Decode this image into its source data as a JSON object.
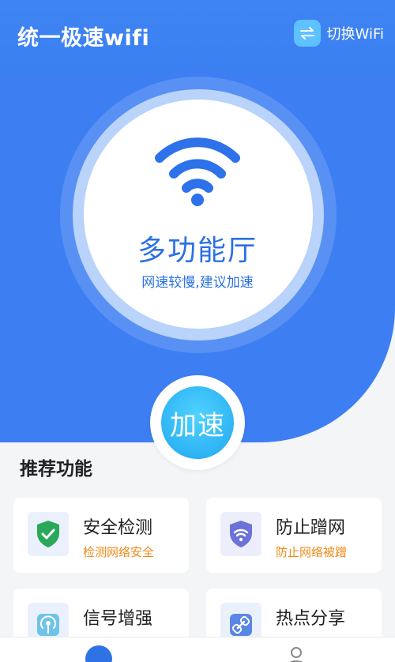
{
  "header": {
    "title": "统一极速wifi",
    "switch_label": "切换WiFi"
  },
  "hero": {
    "title": "多功能厅",
    "subtitle": "网速较慢,建议加速",
    "speed_button": "加速"
  },
  "section": {
    "title": "推荐功能"
  },
  "cards": [
    {
      "title": "安全检测",
      "subtitle": "检测网络安全",
      "icon": "shield-check-icon"
    },
    {
      "title": "防止蹭网",
      "subtitle": "防止网络被蹭",
      "icon": "shield-wifi-icon"
    },
    {
      "title": "信号增强",
      "subtitle": "",
      "icon": "signal-icon"
    },
    {
      "title": "热点分享",
      "subtitle": "",
      "icon": "link-icon"
    }
  ],
  "colors": {
    "primary": "#3d7ff2",
    "accent": "#21a6f0",
    "warning_text": "#f08a18"
  }
}
